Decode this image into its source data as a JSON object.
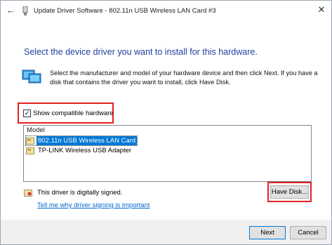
{
  "window": {
    "title": "Update Driver Software - 802.11n USB Wireless LAN Card #3",
    "back_icon": "back-arrow-icon",
    "close_glyph": "✕"
  },
  "heading": "Select the device driver you want to install for this hardware.",
  "description": "Select the manufacturer and model of your hardware device and then click Next. If you have a disk that contains the driver you want to install, click Have Disk.",
  "show_compatible": {
    "label": "Show compatible hardware",
    "checked": true,
    "check_glyph": "✓"
  },
  "model_list": {
    "header": "Model",
    "items": [
      {
        "label": "802.11n USB Wireless LAN Card",
        "selected": true
      },
      {
        "label": "TP-LINK Wireless USB Adapter",
        "selected": false
      }
    ]
  },
  "signature": {
    "text": "This driver is digitally signed.",
    "link": "Tell me why driver signing is important"
  },
  "buttons": {
    "have_disk": "Have Disk...",
    "next": "Next",
    "cancel": "Cancel"
  },
  "colors": {
    "accent": "#0078d7",
    "heading": "#1e3f9f",
    "highlight": "#e32020",
    "link": "#0066cc"
  }
}
